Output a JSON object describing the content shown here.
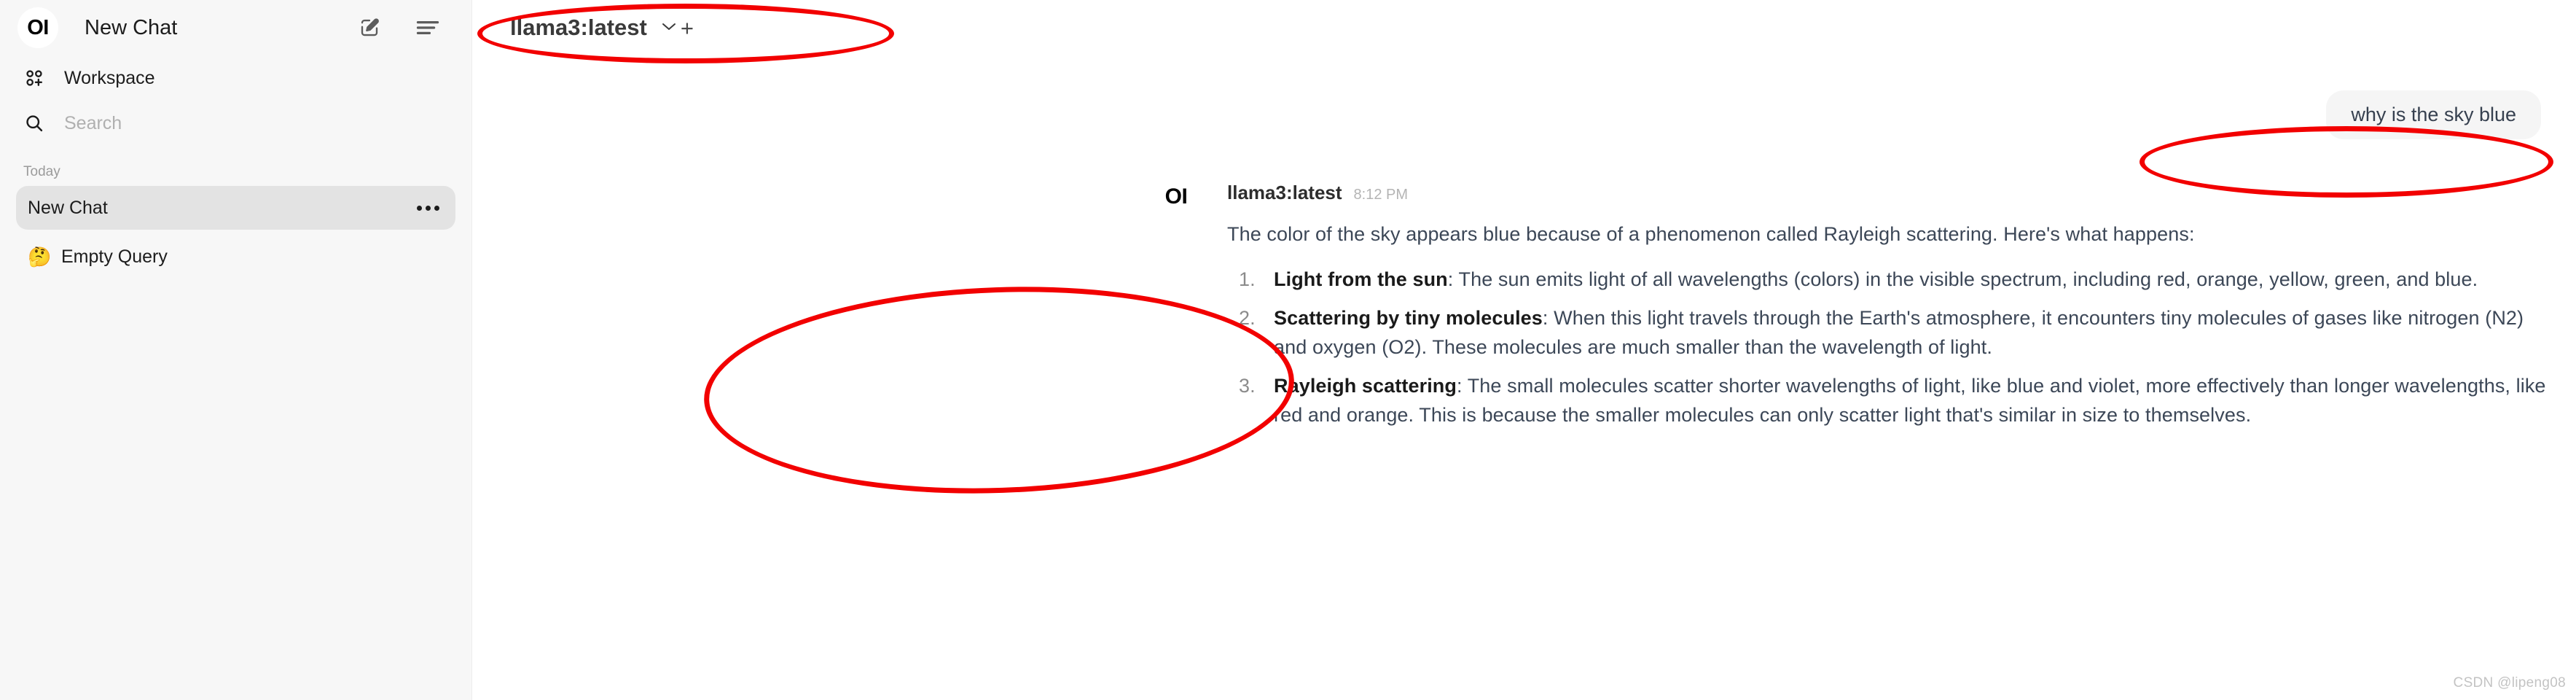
{
  "sidebar": {
    "logo_text": "OI",
    "title": "New Chat",
    "actions": [
      {
        "name": "new-chat-icon",
        "label": "New Chat"
      },
      {
        "name": "toggle-sidebar-icon",
        "label": "Toggle Sidebar"
      }
    ],
    "workspace": {
      "label": "Workspace",
      "icon": "workspace-grid-icon"
    },
    "search": {
      "placeholder": "Search",
      "value": "",
      "icon": "search-icon"
    },
    "section_label": "Today",
    "chats": [
      {
        "label": "New Chat",
        "active": true,
        "menu_icon": "more-options-icon"
      }
    ],
    "extra_item": {
      "emoji": "🤔",
      "label": "Empty Query"
    }
  },
  "header": {
    "model_name": "llama3:latest",
    "dropdown_icon": "chevron-down-icon",
    "add_model_label": "+"
  },
  "conversation": {
    "user_message": "why is the sky blue",
    "assistant": {
      "avatar_text": "OI",
      "name": "llama3:latest",
      "time": "8:12 PM",
      "intro": "The color of the sky appears blue because of a phenomenon called Rayleigh scattering. Here's what happens:",
      "items": [
        {
          "title": "Light from the sun",
          "text": ": The sun emits light of all wavelengths (colors) in the visible spectrum, including red, orange, yellow, green, and blue."
        },
        {
          "title": "Scattering by tiny molecules",
          "text": ": When this light travels through the Earth's atmosphere, it encounters tiny molecules of gases like nitrogen (N2) and oxygen (O2). These molecules are much smaller than the wavelength of light."
        },
        {
          "title": "Rayleigh scattering",
          "text": ": The small molecules scatter shorter wavelengths of light, like blue and violet, more effectively than longer wavelengths, like red and orange. This is because the smaller molecules can only scatter light that's similar in size to themselves."
        }
      ]
    }
  },
  "watermark": "CSDN @lipeng08",
  "annotations": {
    "color": "#f20000",
    "shapes": [
      {
        "name": "model-selector-highlight"
      },
      {
        "name": "user-message-highlight"
      },
      {
        "name": "assistant-message-highlight"
      }
    ]
  }
}
